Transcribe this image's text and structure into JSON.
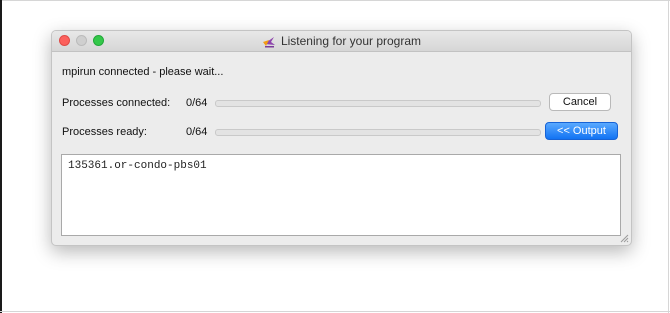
{
  "window": {
    "title": "Listening for your program"
  },
  "status": {
    "message": "mpirun connected - please wait..."
  },
  "rows": [
    {
      "label": "Processes connected:",
      "count": "0/64",
      "progress_fraction": 0
    },
    {
      "label": "Processes ready:",
      "count": "0/64",
      "progress_fraction": 0
    }
  ],
  "buttons": {
    "cancel": "Cancel",
    "output": "<< Output"
  },
  "output": {
    "text": "135361.or-condo-pbs01"
  },
  "colors": {
    "accent": "#1273f3",
    "close": "#fc605c",
    "zoom": "#34c84a"
  },
  "icons": {
    "title": "allinea-forge-icon"
  }
}
